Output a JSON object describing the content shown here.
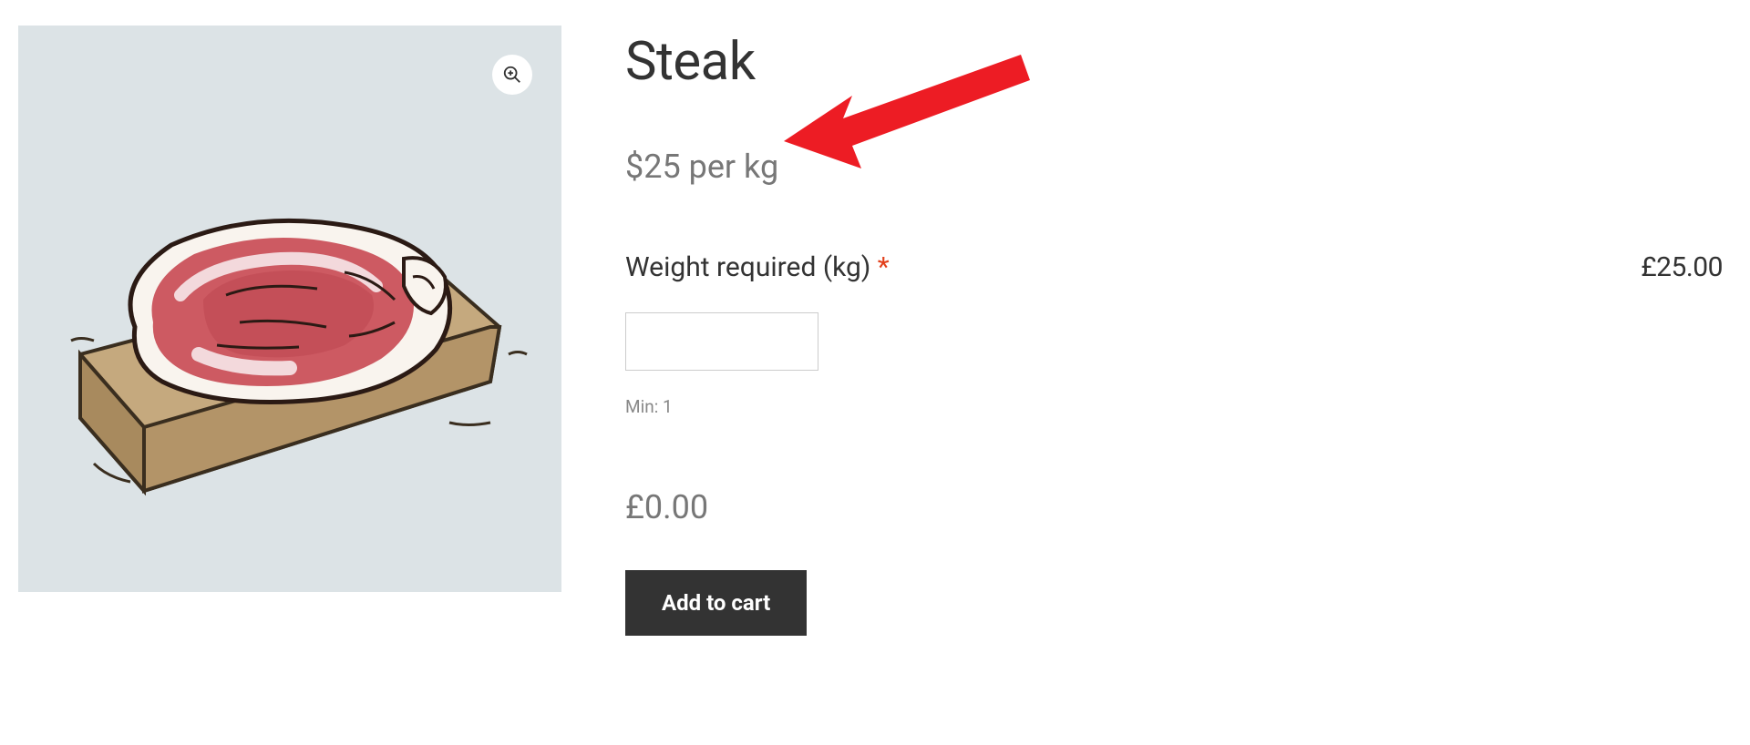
{
  "product": {
    "title": "Steak",
    "price_per_unit": "$25 per kg",
    "line_price": "£25.00",
    "running_total": "£0.00"
  },
  "form": {
    "weight_label": "Weight required (kg) ",
    "required_mark": "*",
    "min_text": "Min: 1",
    "weight_value": ""
  },
  "actions": {
    "add_to_cart": "Add to cart"
  },
  "colors": {
    "accent_red": "#e2401c",
    "button_bg": "#333333",
    "muted": "#777777"
  }
}
